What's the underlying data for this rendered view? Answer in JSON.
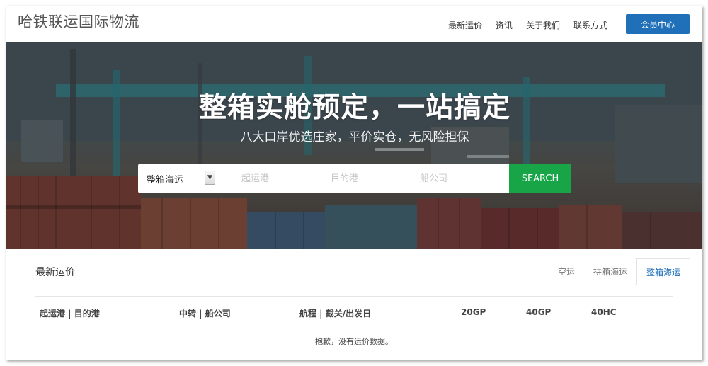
{
  "header": {
    "logo": "哈铁联运国际物流",
    "nav": [
      "最新运价",
      "资讯",
      "关于我们",
      "联系方式"
    ],
    "member_button": "会员中心"
  },
  "hero": {
    "title": "整箱实舱预定，一站搞定",
    "subtitle": "八大口岸优选庄家，平价实仓，无风险担保"
  },
  "search": {
    "type_selected": "整箱海运",
    "origin_placeholder": "起运港",
    "destination_placeholder": "目的港",
    "carrier_placeholder": "船公司",
    "button_label": "SEARCH"
  },
  "rates": {
    "title": "最新运价",
    "tabs": [
      "空运",
      "拼箱海运",
      "整箱海运"
    ],
    "active_tab": 2,
    "columns": [
      "起运港 | 目的港",
      "中转 | 船公司",
      "航程 | 截关/出发日",
      "20GP",
      "40GP",
      "40HC"
    ],
    "empty_message": "抱歉，没有运价数据。"
  },
  "colors": {
    "primary_blue": "#1f6fb9",
    "search_green": "#17a548"
  }
}
